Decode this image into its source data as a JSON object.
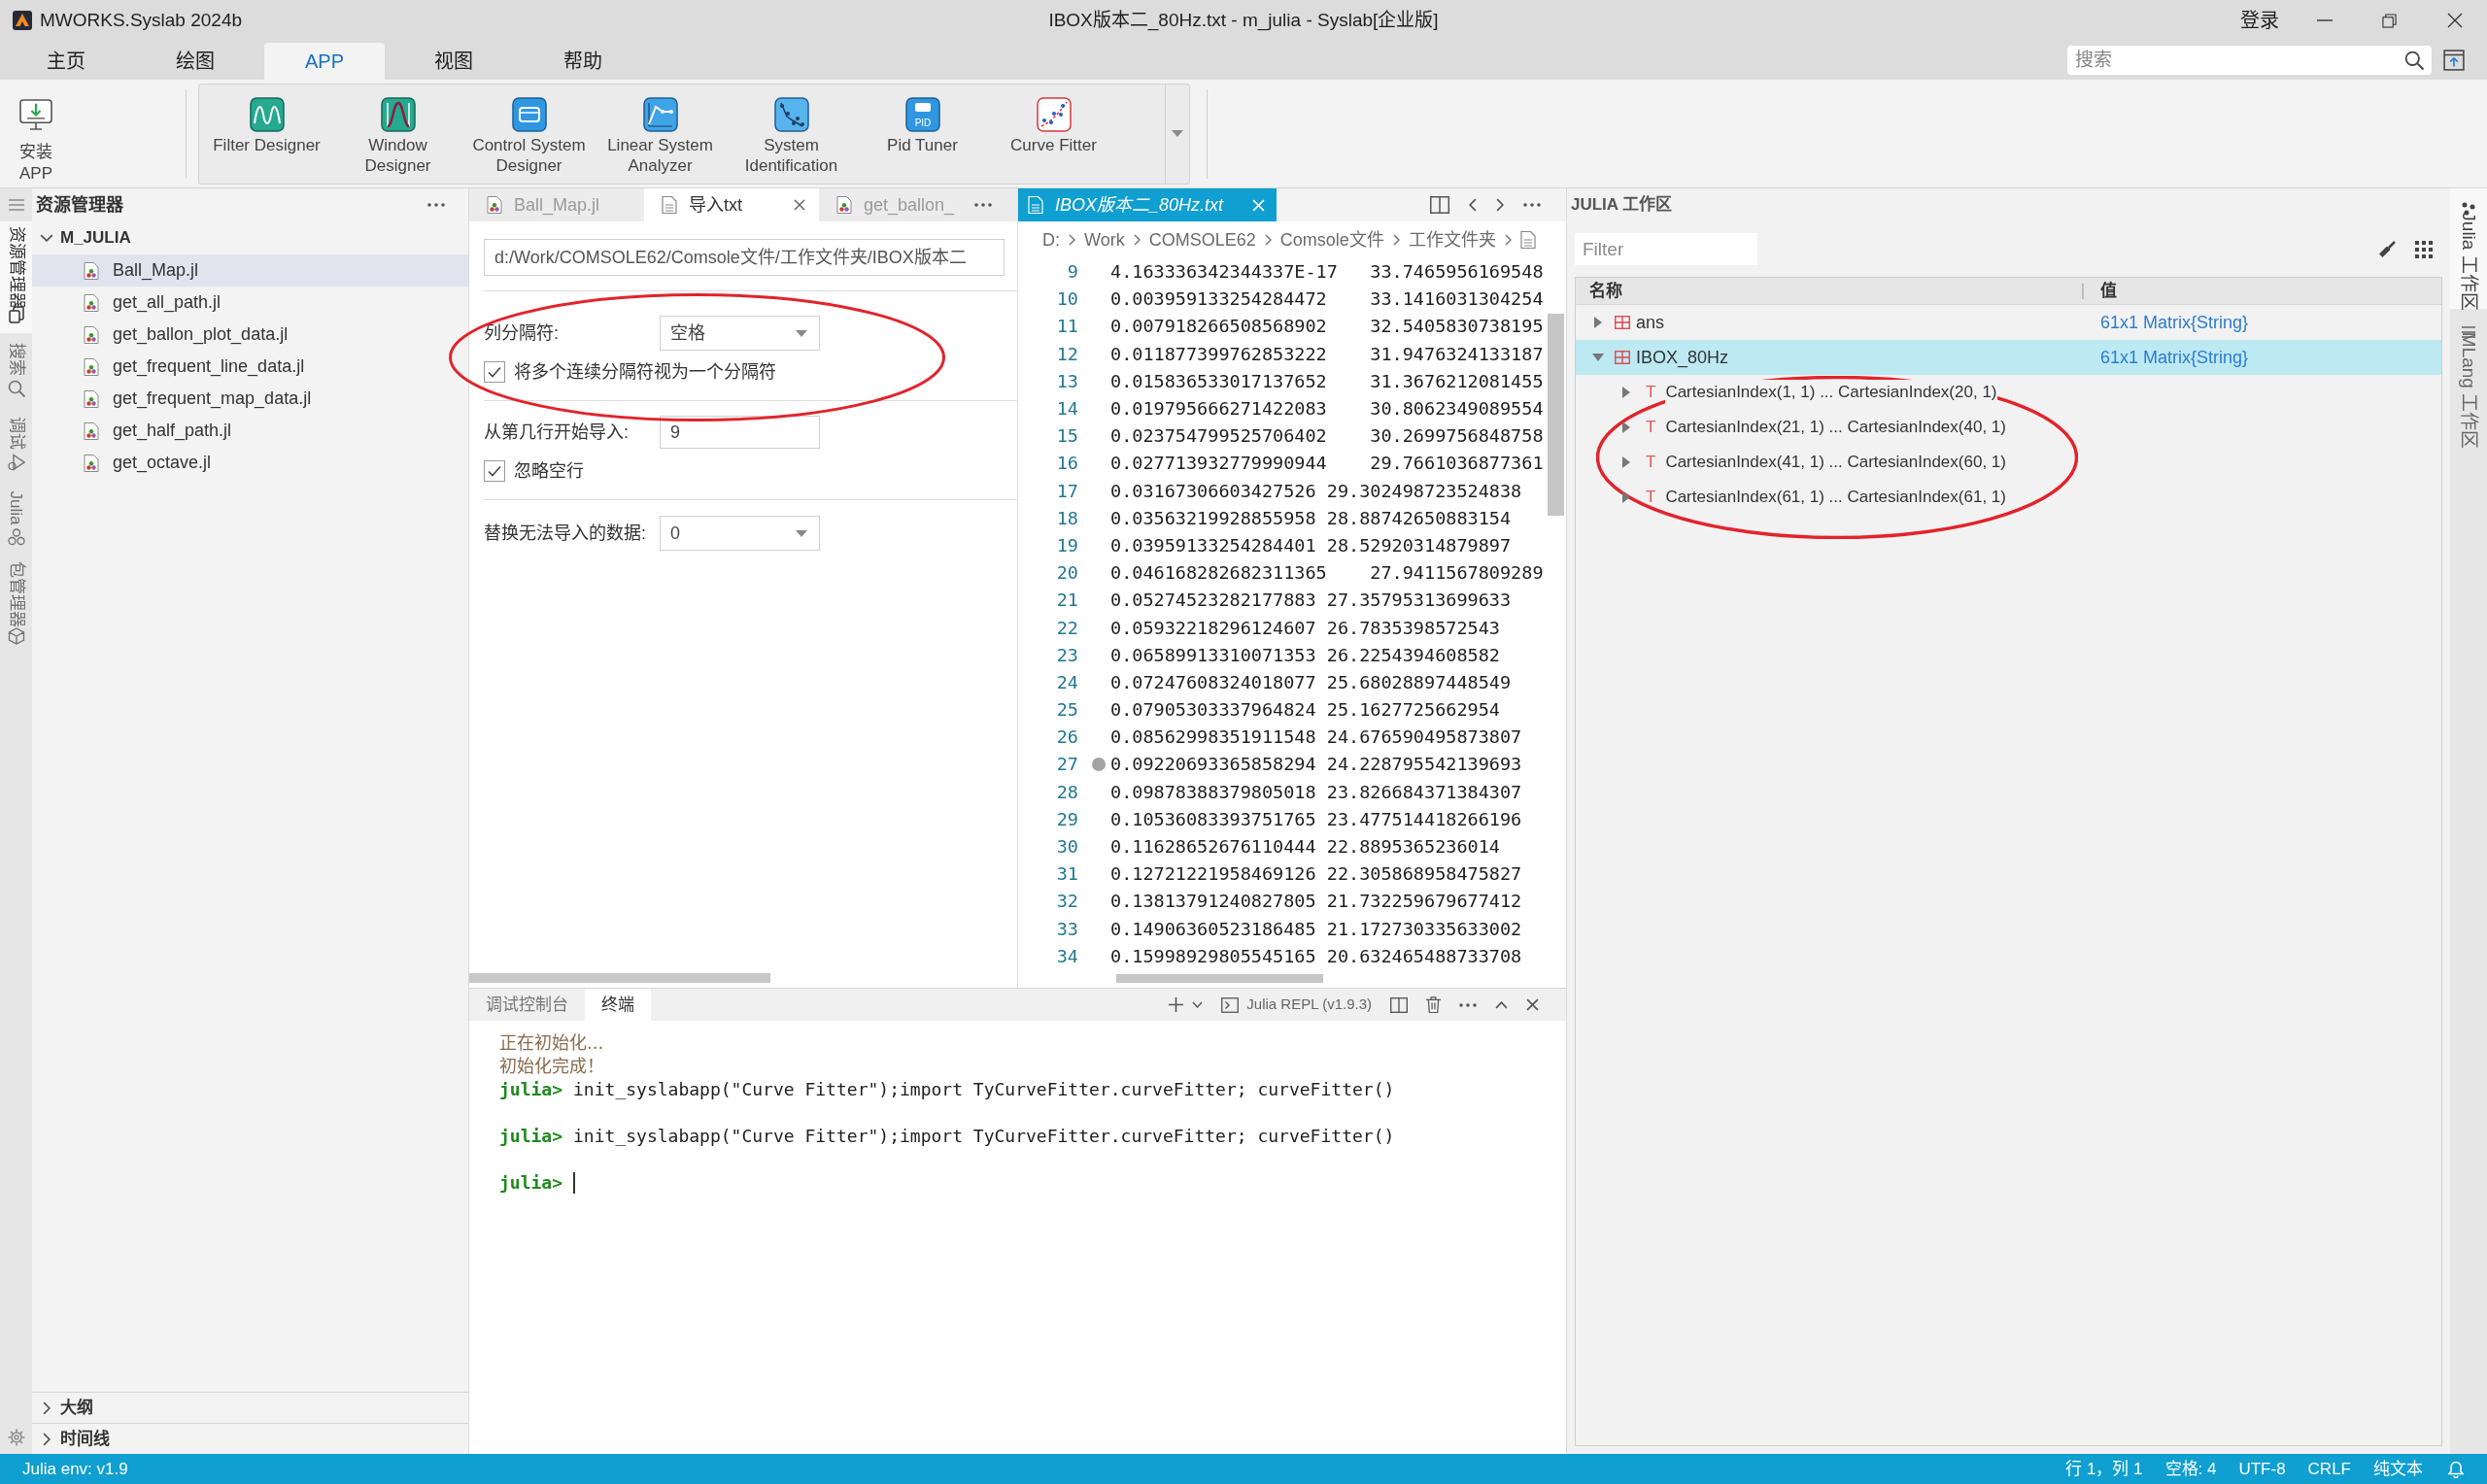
{
  "title_bar": {
    "app_name": "MWORKS.Syslab 2024b",
    "title": "IBOX版本二_80Hz.txt - m_julia - Syslab[企业版]",
    "login": "登录"
  },
  "menu_tabs": [
    {
      "label": "主页",
      "selected": false
    },
    {
      "label": "绘图",
      "selected": false
    },
    {
      "label": "APP",
      "selected": true
    },
    {
      "label": "视图",
      "selected": false
    },
    {
      "label": "帮助",
      "selected": false
    }
  ],
  "search": {
    "placeholder": "搜索"
  },
  "ribbon": {
    "install": {
      "label": "安装 APP"
    },
    "apps": [
      {
        "label": "Filter Designer"
      },
      {
        "label": "Window Designer"
      },
      {
        "label": "Control System Designer"
      },
      {
        "label": "Linear System Analyzer"
      },
      {
        "label": "System Identification"
      },
      {
        "label": "Pid Tuner",
        "icon_text": "PID"
      },
      {
        "label": "Curve Fitter"
      }
    ]
  },
  "activity_bar": [
    {
      "label": "资源管理器",
      "selected": true
    },
    {
      "label": "搜索",
      "selected": false
    },
    {
      "label": "调试",
      "selected": false
    },
    {
      "label": "Julia",
      "selected": false
    },
    {
      "label": "包管理器",
      "selected": false
    }
  ],
  "explorer": {
    "title": "资源管理器",
    "folder": {
      "name": "M_JULIA",
      "expanded": true,
      "files": [
        {
          "name": "Ball_Map.jl",
          "selected": true
        },
        {
          "name": "get_all_path.jl",
          "selected": false
        },
        {
          "name": "get_ballon_plot_data.jl",
          "selected": false
        },
        {
          "name": "get_frequent_line_data.jl",
          "selected": false
        },
        {
          "name": "get_frequent_map_data.jl",
          "selected": false
        },
        {
          "name": "get_half_path.jl",
          "selected": false
        },
        {
          "name": "get_octave.jl",
          "selected": false
        }
      ]
    },
    "sections": [
      {
        "label": "大纲",
        "expanded": false
      },
      {
        "label": "时间线",
        "expanded": false
      }
    ]
  },
  "import_panel": {
    "tabs": [
      {
        "label": "Ball_Map.jl",
        "kind": "script",
        "selected": false
      },
      {
        "label": "导入txt",
        "kind": "tool",
        "selected": true
      },
      {
        "label": "get_ballon_",
        "kind": "script",
        "selected": false
      }
    ],
    "path": "d:/Work/COMSOLE62/Comsole文件/工作文件夹/IBOX版本二",
    "delimiter_section": {
      "circled": true,
      "label": "列分隔符:",
      "value": "空格",
      "merge": {
        "label": "将多个连续分隔符视为一个分隔符",
        "checked": true
      }
    },
    "start_section": {
      "label": "从第几行开始导入:",
      "value": "9",
      "ignore_empty": {
        "label": "忽略空行",
        "checked": true
      }
    },
    "replace": {
      "label": "替换无法导入的数据:",
      "value": "0"
    }
  },
  "editor": {
    "tab": {
      "label": "IBOX版本二_80Hz.txt",
      "selected": true
    },
    "breadcrumb": [
      "D:",
      "Work",
      "COMSOLE62",
      "Comsole文件",
      "工作文件夹"
    ],
    "lines": [
      {
        "number": "9",
        "text": "4.163336342344337E-17\t33.7465956169548",
        "marker": false
      },
      {
        "number": "10",
        "text": "0.003959133254284472\t33.1416031304254",
        "marker": false
      },
      {
        "number": "11",
        "text": "0.007918266508568902\t32.5405830738195",
        "marker": false
      },
      {
        "number": "12",
        "text": "0.011877399762853222\t31.9476324133187",
        "marker": false
      },
      {
        "number": "13",
        "text": "0.015836533017137652\t31.3676212081455",
        "marker": false
      },
      {
        "number": "14",
        "text": "0.019795666271422083\t30.8062349089554",
        "marker": false
      },
      {
        "number": "15",
        "text": "0.023754799525706402\t30.2699756848758",
        "marker": false
      },
      {
        "number": "16",
        "text": "0.027713932779990944\t29.7661036877361",
        "marker": false
      },
      {
        "number": "17",
        "text": "0.03167306603427526\t29.302498723524838",
        "marker": false
      },
      {
        "number": "18",
        "text": "0.03563219928855958\t28.88742650883154",
        "marker": false
      },
      {
        "number": "19",
        "text": "0.03959133254284401\t28.52920314879897",
        "marker": false
      },
      {
        "number": "20",
        "text": "0.046168282682311365\t27.9411567809289",
        "marker": false
      },
      {
        "number": "21",
        "text": "0.05274523282177883\t27.35795313699633",
        "marker": false
      },
      {
        "number": "22",
        "text": "0.05932218296124607\t26.7835398572543",
        "marker": false
      },
      {
        "number": "23",
        "text": "0.06589913310071353\t26.2254394608582",
        "marker": false
      },
      {
        "number": "24",
        "text": "0.07247608324018077\t25.68028897448549",
        "marker": false
      },
      {
        "number": "25",
        "text": "0.07905303337964824\t25.1627725662954",
        "marker": false
      },
      {
        "number": "26",
        "text": "0.08562998351911548\t24.676590495873807",
        "marker": false
      },
      {
        "number": "27",
        "text": "0.09220693365858294\t24.228795542139693",
        "marker": true
      },
      {
        "number": "28",
        "text": "0.09878388379805018\t23.826684371384307",
        "marker": false
      },
      {
        "number": "29",
        "text": "0.10536083393751765\t23.477514418266196",
        "marker": false
      },
      {
        "number": "30",
        "text": "0.11628652676110444\t22.8895365236014",
        "marker": false
      },
      {
        "number": "31",
        "text": "0.12721221958469126\t22.305868958475827",
        "marker": false
      },
      {
        "number": "32",
        "text": "0.13813791240827805\t21.732259679677412",
        "marker": false
      },
      {
        "number": "33",
        "text": "0.14906360523186485\t21.172730335633002",
        "marker": false
      },
      {
        "number": "34",
        "text": "0.15998929805545165\t20.632465488733708",
        "marker": false
      }
    ]
  },
  "panel": {
    "tabs": [
      {
        "label": "调试控制台",
        "selected": false
      },
      {
        "label": "终端",
        "selected": true
      }
    ],
    "terminal_name": "Julia REPL (v1.9.3)",
    "terminal": [
      {
        "kind": "info",
        "text": "正在初始化..."
      },
      {
        "kind": "info",
        "text": "初始化完成！"
      },
      {
        "kind": "command",
        "prompt": "julia>",
        "text": "init_syslabapp(\"Curve Fitter\");import TyCurveFitter.curveFitter; curveFitter()"
      },
      {
        "kind": "command",
        "prompt": "julia>",
        "text": "init_syslabapp(\"Curve Fitter\");import TyCurveFitter.curveFitter; curveFitter()"
      },
      {
        "kind": "prompt",
        "prompt": "julia>",
        "cursor": true
      }
    ]
  },
  "workspace": {
    "title": "JULIA 工作区",
    "filter": {
      "placeholder": "Filter"
    },
    "columns": [
      "名称",
      "值"
    ],
    "variables": [
      {
        "name": "ans",
        "value": "61x1 Matrix{String}",
        "expanded": false,
        "selected": false
      },
      {
        "name": "IBOX_80Hz",
        "value": "61x1 Matrix{String}",
        "expanded": true,
        "selected": true,
        "children_circled": true,
        "children": [
          {
            "type_mark": "T",
            "name": "CartesianIndex(1, 1) ... CartesianIndex(20, 1)",
            "expanded": false
          },
          {
            "type_mark": "T",
            "name": "CartesianIndex(21, 1) ... CartesianIndex(40, 1)",
            "expanded": false
          },
          {
            "type_mark": "T",
            "name": "CartesianIndex(41, 1) ... CartesianIndex(60, 1)",
            "expanded": false
          },
          {
            "type_mark": "T",
            "name": "CartesianIndex(61, 1) ... CartesianIndex(61, 1)",
            "expanded": false
          }
        ]
      }
    ]
  },
  "side_tabs": [
    {
      "label": "Julia 工作区",
      "selected": true
    },
    {
      "label": "MLang 工作区",
      "selected": false
    }
  ],
  "status_bar": {
    "env": "Julia env: v1.9",
    "items": [
      "行 1，列 1",
      "空格: 4",
      "UTF-8",
      "CRLF",
      "纯文本"
    ]
  }
}
